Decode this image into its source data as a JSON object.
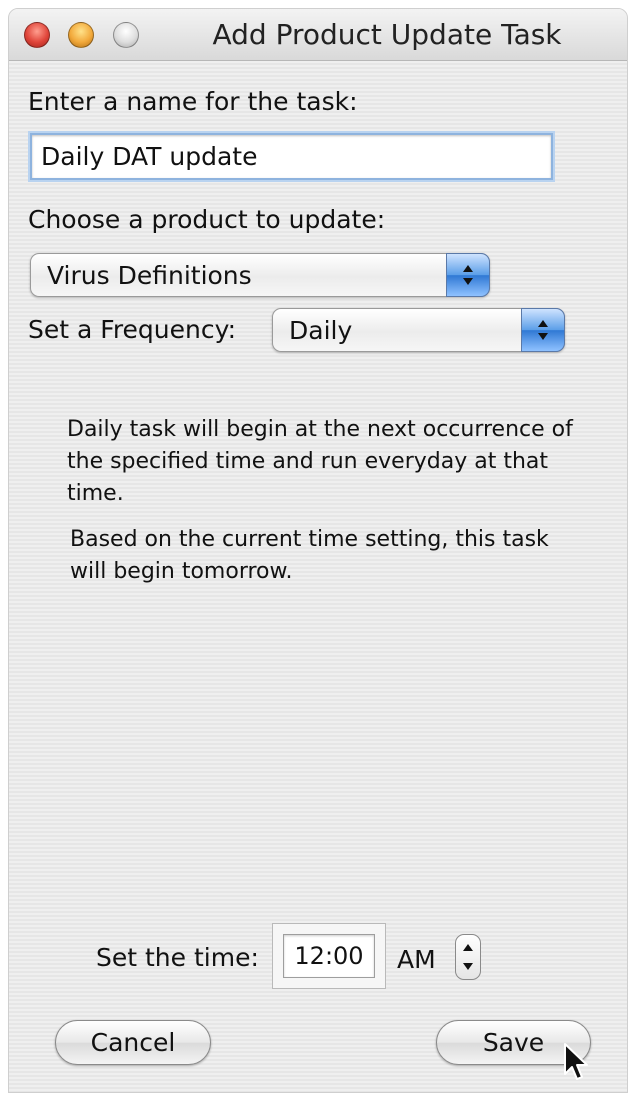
{
  "window": {
    "title": "Add Product Update Task"
  },
  "task_name": {
    "label": "Enter a name for the task:",
    "value": "Daily DAT update"
  },
  "product": {
    "label": "Choose a product to update:",
    "selected": "Virus Definitions"
  },
  "frequency": {
    "label": "Set a Frequency:",
    "selected": "Daily"
  },
  "description": {
    "line1": "Daily task will begin at the next occurrence of the specified time and run everyday at that time.",
    "line2": "Based on the current time setting, this task will begin tomorrow."
  },
  "time": {
    "label": "Set the time:",
    "value": "12:00",
    "ampm": "AM"
  },
  "buttons": {
    "cancel": "Cancel",
    "save": "Save"
  },
  "icons": [
    "close-light-icon",
    "minimize-light-icon",
    "zoom-light-icon",
    "popup-arrows-icon",
    "stepper-icon",
    "mouse-pointer-icon"
  ],
  "colors": {
    "accent_blue": "#5b9ee8",
    "close_red": "#e0453a",
    "min_yellow": "#f2a93b"
  }
}
